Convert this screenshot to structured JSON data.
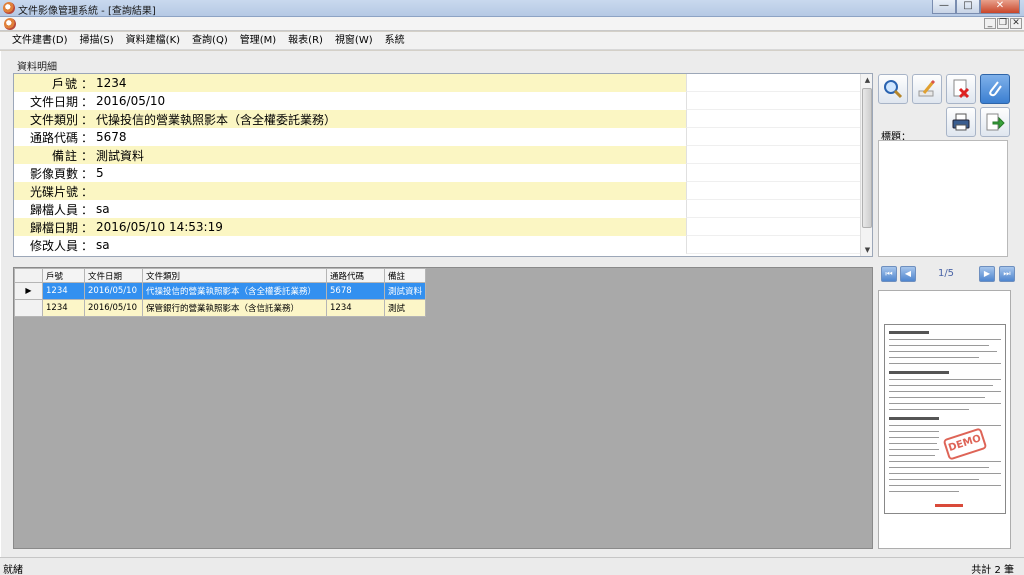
{
  "window": {
    "title": "文件影像管理系統 - [查詢結果]",
    "minimize_label": "—",
    "maximize_label": "□",
    "close_label": "✕"
  },
  "mdi": {
    "minimize_label": "_",
    "restore_label": "❐",
    "close_label": "✕"
  },
  "menu": [
    "文件建書(D)",
    "掃描(S)",
    "資料建檔(K)",
    "查詢(Q)",
    "管理(M)",
    "報表(R)",
    "視窗(W)",
    "系統"
  ],
  "section_label": "資料明細",
  "detail": [
    {
      "label": "戶號",
      "value": "1234"
    },
    {
      "label": "文件日期",
      "value": "2016/05/10"
    },
    {
      "label": "文件類別",
      "value": "代操投信的營業執照影本（含全權委託業務）"
    },
    {
      "label": "通路代碼",
      "value": "5678"
    },
    {
      "label": "備註",
      "value": "測試資料"
    },
    {
      "label": "影像頁數",
      "value": "5"
    },
    {
      "label": "光碟片號",
      "value": ""
    },
    {
      "label": "歸檔人員",
      "value": "sa"
    },
    {
      "label": "歸檔日期",
      "value": "2016/05/10 14:53:19"
    },
    {
      "label": "修改人員",
      "value": "sa"
    }
  ],
  "detail_colon": "：",
  "toolbar": {
    "icons": [
      "search-icon",
      "edit-icon",
      "delete-icon",
      "attach-icon",
      "print-icon",
      "export-icon"
    ]
  },
  "title_label": "標題：",
  "grid": {
    "columns": [
      "戶號",
      "文件日期",
      "文件類別",
      "通路代碼",
      "備註"
    ],
    "rows": [
      [
        "1234",
        "2016/05/10",
        "代操投信的營業執照影本（含全權委託業務）",
        "5678",
        "測試資料"
      ],
      [
        "1234",
        "2016/05/10",
        "保管銀行的營業執照影本（含信託業務）",
        "1234",
        "測試"
      ]
    ],
    "selected_row": 0
  },
  "pager": {
    "text": "1/5"
  },
  "thumbnail": {
    "stamp_text": "DEMO"
  },
  "status": {
    "left": "就緒",
    "right": "共計 2 筆"
  },
  "colors": {
    "highlight_row": "#fbf6c3",
    "selected_row": "#3390f0",
    "grid_background": "#a9a9a9"
  }
}
